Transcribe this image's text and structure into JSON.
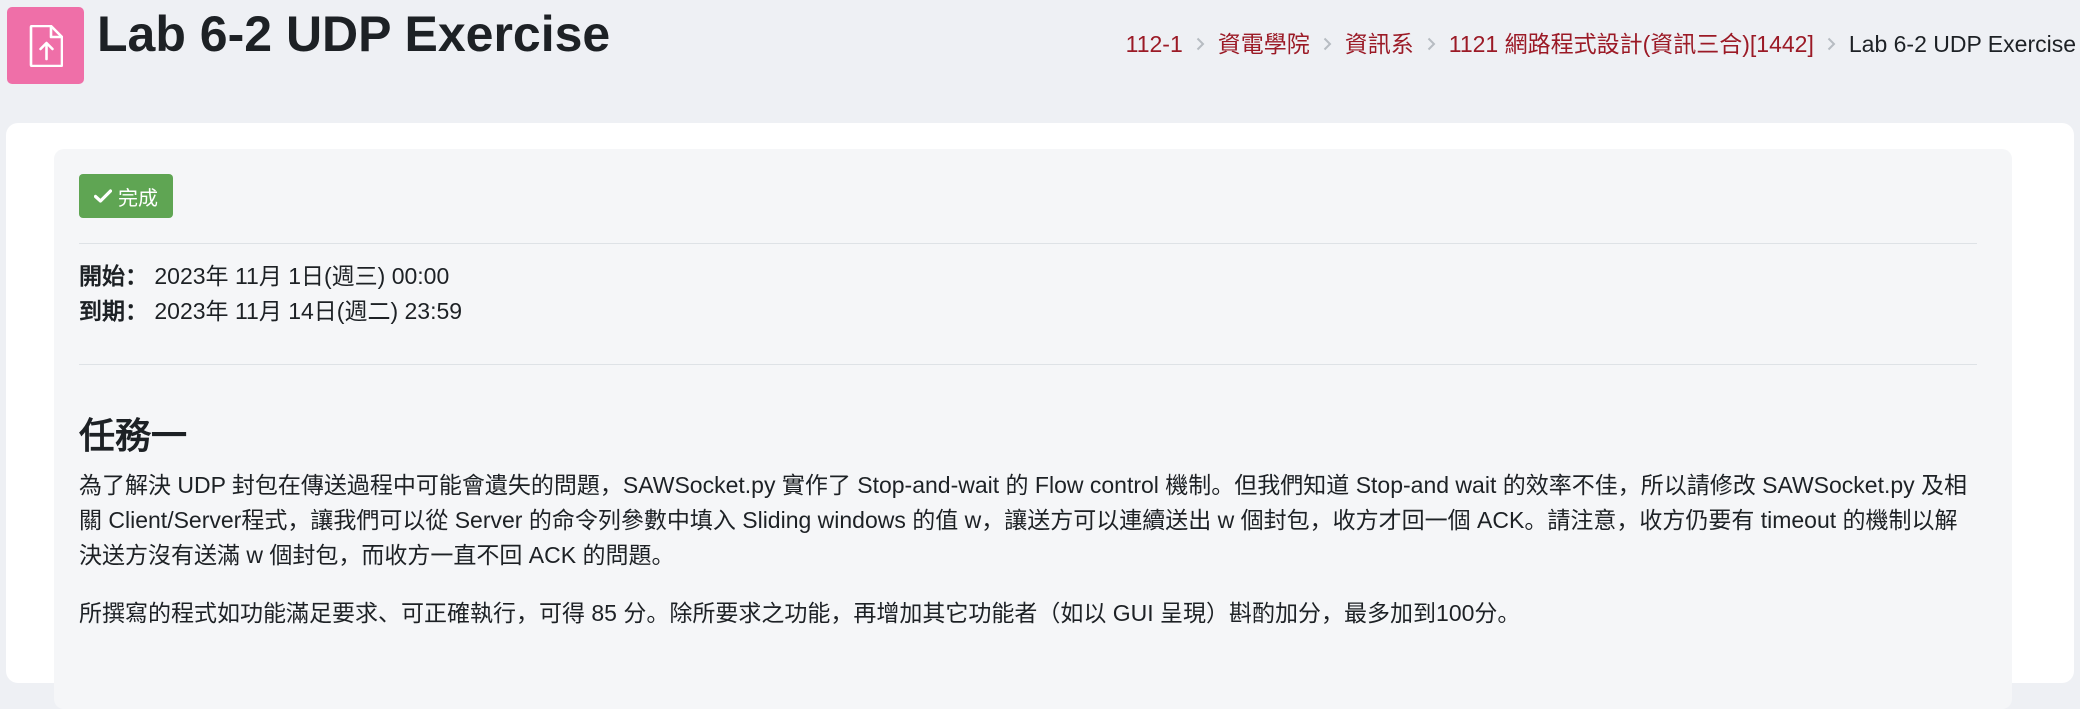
{
  "header": {
    "title": "Lab 6-2 UDP Exercise",
    "icon": "file-upload-icon",
    "icon_color": "#ef6fa8"
  },
  "breadcrumb": {
    "items": [
      {
        "label": "112-1"
      },
      {
        "label": "資電學院"
      },
      {
        "label": "資訊系"
      },
      {
        "label": "1121 網路程式設計(資訊三合)[1442]"
      }
    ],
    "current": "Lab 6-2 UDP Exercise",
    "link_color": "#9b1a26"
  },
  "completion": {
    "badge_label": "完成",
    "badge_color": "#5fa553",
    "icon": "check-icon"
  },
  "dates": {
    "open_label": "開始：",
    "open_value": "2023年 11月 1日(週三) 00:00",
    "due_label": "到期：",
    "due_value": "2023年 11月 14日(週二) 23:59"
  },
  "task": {
    "heading": "任務一",
    "paragraph1": "為了解決 UDP 封包在傳送過程中可能會遺失的問題，SAWSocket.py 實作了 Stop-and-wait 的 Flow control 機制。但我們知道 Stop-and wait 的效率不佳，所以請修改 SAWSocket.py 及相關 Client/Server程式，讓我們可以從 Server 的命令列參數中填入 Sliding windows 的值 w，讓送方可以連續送出 w 個封包，收方才回一個 ACK。請注意，收方仍要有 timeout 的機制以解決送方沒有送滿 w 個封包，而收方一直不回 ACK 的問題。",
    "paragraph2": "所撰寫的程式如功能滿足要求、可正確執行，可得 85 分。除所要求之功能，再增加其它功能者（如以 GUI 呈現）斟酌加分，最多加到100分。"
  }
}
